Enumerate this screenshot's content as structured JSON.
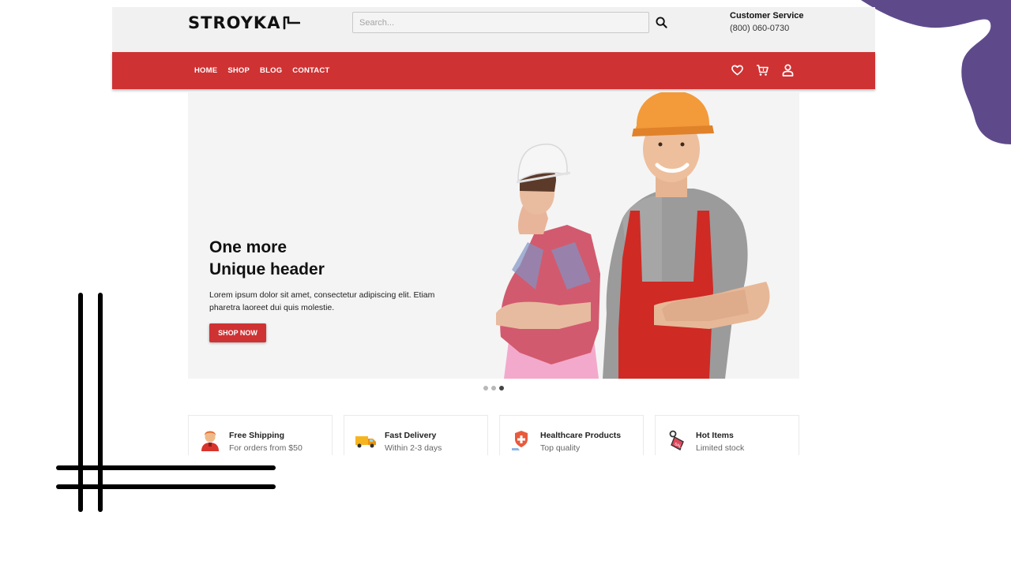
{
  "brand": {
    "logo_text": "STROYKA"
  },
  "search": {
    "placeholder": "Search..."
  },
  "customer_service": {
    "title": "Customer Service",
    "phone": "(800) 060-0730"
  },
  "nav": {
    "links": [
      "HOME",
      "SHOP",
      "BLOG",
      "CONTACT"
    ]
  },
  "nav_icons": [
    "heart-icon",
    "cart-icon",
    "user-icon"
  ],
  "hero": {
    "title_line1": "One more",
    "title_line2": "Unique header",
    "text": "Lorem ipsum dolor sit amet, consectetur adipiscing elit. Etiam pharetra laoreet dui quis molestie.",
    "button": "SHOP NOW"
  },
  "slider": {
    "active_index": 2
  },
  "features": [
    {
      "title": "Free Shipping",
      "subtitle": "For orders from $50",
      "icon": "support-agent-icon"
    },
    {
      "title": "Fast Delivery",
      "subtitle": "Within 2-3 days",
      "icon": "delivery-truck-icon"
    },
    {
      "title": "Healthcare Products",
      "subtitle": "Top quality",
      "icon": "health-shield-icon"
    },
    {
      "title": "Hot Items",
      "subtitle": "Limited stock",
      "icon": "price-tag-icon"
    }
  ],
  "colors": {
    "accent": "#cf3233",
    "decor_purple": "#5e4a8b",
    "topbar_bg": "#f1f1f1"
  }
}
